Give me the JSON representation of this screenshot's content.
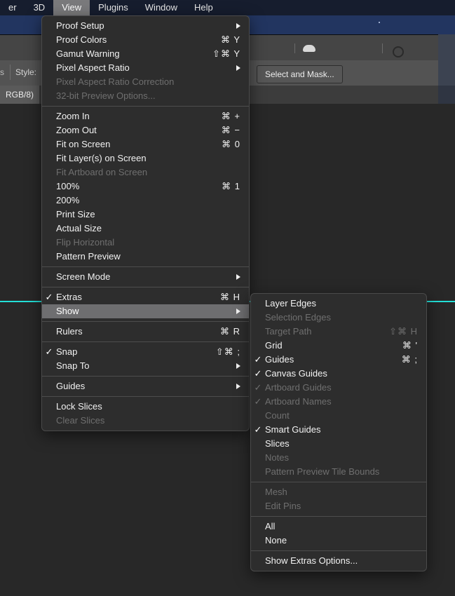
{
  "menubar": {
    "items": [
      {
        "label": "er",
        "active": false
      },
      {
        "label": "3D",
        "active": false
      },
      {
        "label": "View",
        "active": true
      },
      {
        "label": "Plugins",
        "active": false
      },
      {
        "label": "Window",
        "active": false
      },
      {
        "label": "Help",
        "active": false
      }
    ]
  },
  "options_bar": {
    "style_label": "Style:",
    "left_fragment": "s",
    "select_and_mask": "Select and Mask..."
  },
  "document_tab": {
    "label": "RGB/8)"
  },
  "colors": {
    "menubar_bg": "#161d2e",
    "menu_bg": "#2d2d2d",
    "highlight": "#6e6e70",
    "guide_cyan": "#23e0d8",
    "title_bar": "#223560",
    "text": "#f2f2f2",
    "text_disabled": "#6f6f6f"
  },
  "view_menu": {
    "name": "View",
    "groups": [
      [
        {
          "label": "Proof Setup",
          "shortcut": "",
          "checked": false,
          "disabled": false,
          "submenu": true
        },
        {
          "label": "Proof Colors",
          "shortcut": "⌘ Y",
          "checked": false,
          "disabled": false,
          "submenu": false
        },
        {
          "label": "Gamut Warning",
          "shortcut": "⇧⌘ Y",
          "checked": false,
          "disabled": false,
          "submenu": false
        },
        {
          "label": "Pixel Aspect Ratio",
          "shortcut": "",
          "checked": false,
          "disabled": false,
          "submenu": true
        },
        {
          "label": "Pixel Aspect Ratio Correction",
          "shortcut": "",
          "checked": false,
          "disabled": true,
          "submenu": false
        },
        {
          "label": "32-bit Preview Options...",
          "shortcut": "",
          "checked": false,
          "disabled": true,
          "submenu": false
        }
      ],
      [
        {
          "label": "Zoom In",
          "shortcut": "⌘ +",
          "checked": false,
          "disabled": false,
          "submenu": false
        },
        {
          "label": "Zoom Out",
          "shortcut": "⌘ −",
          "checked": false,
          "disabled": false,
          "submenu": false
        },
        {
          "label": "Fit on Screen",
          "shortcut": "⌘ 0",
          "checked": false,
          "disabled": false,
          "submenu": false
        },
        {
          "label": "Fit Layer(s) on Screen",
          "shortcut": "",
          "checked": false,
          "disabled": false,
          "submenu": false
        },
        {
          "label": "Fit Artboard on Screen",
          "shortcut": "",
          "checked": false,
          "disabled": true,
          "submenu": false
        },
        {
          "label": "100%",
          "shortcut": "⌘ 1",
          "checked": false,
          "disabled": false,
          "submenu": false
        },
        {
          "label": "200%",
          "shortcut": "",
          "checked": false,
          "disabled": false,
          "submenu": false
        },
        {
          "label": "Print Size",
          "shortcut": "",
          "checked": false,
          "disabled": false,
          "submenu": false
        },
        {
          "label": "Actual Size",
          "shortcut": "",
          "checked": false,
          "disabled": false,
          "submenu": false
        },
        {
          "label": "Flip Horizontal",
          "shortcut": "",
          "checked": false,
          "disabled": true,
          "submenu": false
        },
        {
          "label": "Pattern Preview",
          "shortcut": "",
          "checked": false,
          "disabled": false,
          "submenu": false
        }
      ],
      [
        {
          "label": "Screen Mode",
          "shortcut": "",
          "checked": false,
          "disabled": false,
          "submenu": true
        }
      ],
      [
        {
          "label": "Extras",
          "shortcut": "⌘ H",
          "checked": true,
          "disabled": false,
          "submenu": false
        },
        {
          "label": "Show",
          "shortcut": "",
          "checked": false,
          "disabled": false,
          "submenu": true,
          "highlighted": true
        }
      ],
      [
        {
          "label": "Rulers",
          "shortcut": "⌘ R",
          "checked": false,
          "disabled": false,
          "submenu": false
        }
      ],
      [
        {
          "label": "Snap",
          "shortcut": "⇧⌘ ;",
          "checked": true,
          "disabled": false,
          "submenu": false
        },
        {
          "label": "Snap To",
          "shortcut": "",
          "checked": false,
          "disabled": false,
          "submenu": true
        }
      ],
      [
        {
          "label": "Guides",
          "shortcut": "",
          "checked": false,
          "disabled": false,
          "submenu": true
        }
      ],
      [
        {
          "label": "Lock Slices",
          "shortcut": "",
          "checked": false,
          "disabled": false,
          "submenu": false
        },
        {
          "label": "Clear Slices",
          "shortcut": "",
          "checked": false,
          "disabled": true,
          "submenu": false
        }
      ]
    ]
  },
  "show_submenu": {
    "name": "Show",
    "groups": [
      [
        {
          "label": "Layer Edges",
          "shortcut": "",
          "checked": false,
          "disabled": false,
          "submenu": false
        },
        {
          "label": "Selection Edges",
          "shortcut": "",
          "checked": false,
          "disabled": true,
          "submenu": false
        },
        {
          "label": "Target Path",
          "shortcut": "⇧⌘ H",
          "checked": false,
          "disabled": true,
          "submenu": false
        },
        {
          "label": "Grid",
          "shortcut": "⌘ '",
          "checked": false,
          "disabled": false,
          "submenu": false
        },
        {
          "label": "Guides",
          "shortcut": "⌘ ;",
          "checked": true,
          "disabled": false,
          "submenu": false
        },
        {
          "label": "Canvas Guides",
          "shortcut": "",
          "checked": true,
          "disabled": false,
          "submenu": false
        },
        {
          "label": "Artboard Guides",
          "shortcut": "",
          "checked": true,
          "disabled": true,
          "submenu": false
        },
        {
          "label": "Artboard Names",
          "shortcut": "",
          "checked": true,
          "disabled": true,
          "submenu": false
        },
        {
          "label": "Count",
          "shortcut": "",
          "checked": false,
          "disabled": true,
          "submenu": false
        },
        {
          "label": "Smart Guides",
          "shortcut": "",
          "checked": true,
          "disabled": false,
          "submenu": false
        },
        {
          "label": "Slices",
          "shortcut": "",
          "checked": false,
          "disabled": false,
          "submenu": false
        },
        {
          "label": "Notes",
          "shortcut": "",
          "checked": false,
          "disabled": true,
          "submenu": false
        },
        {
          "label": "Pattern Preview Tile Bounds",
          "shortcut": "",
          "checked": false,
          "disabled": true,
          "submenu": false
        }
      ],
      [
        {
          "label": "Mesh",
          "shortcut": "",
          "checked": false,
          "disabled": true,
          "submenu": false
        },
        {
          "label": "Edit Pins",
          "shortcut": "",
          "checked": false,
          "disabled": true,
          "submenu": false
        }
      ],
      [
        {
          "label": "All",
          "shortcut": "",
          "checked": false,
          "disabled": false,
          "submenu": false
        },
        {
          "label": "None",
          "shortcut": "",
          "checked": false,
          "disabled": false,
          "submenu": false
        }
      ],
      [
        {
          "label": "Show Extras Options...",
          "shortcut": "",
          "checked": false,
          "disabled": false,
          "submenu": false
        }
      ]
    ]
  }
}
